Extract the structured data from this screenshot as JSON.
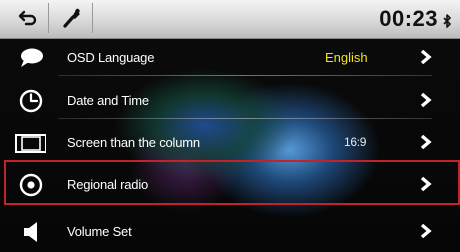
{
  "topbar": {
    "time": "00:23",
    "back_icon": "return-arrow-icon",
    "settings_icon": "wrench-icon",
    "bluetooth_icon": "bluetooth-icon"
  },
  "menu": {
    "items": [
      {
        "label": "OSD Language",
        "value": "English",
        "icon": "speech-bubble-icon",
        "value_color": "#f2e21c"
      },
      {
        "label": "Date and Time",
        "value": "",
        "icon": "clock-icon"
      },
      {
        "label": "Screen than the column",
        "value": "16:9",
        "icon": "aspect-ratio-icon",
        "value_color": "#e8e8e8"
      },
      {
        "label": "Regional radio",
        "value": "",
        "icon": "radio-disc-icon"
      },
      {
        "label": "Volume Set",
        "value": "",
        "icon": "speaker-icon"
      }
    ]
  },
  "colors": {
    "highlight_border": "#c0232a",
    "value_yellow": "#f2e21c",
    "text": "#ffffff"
  }
}
